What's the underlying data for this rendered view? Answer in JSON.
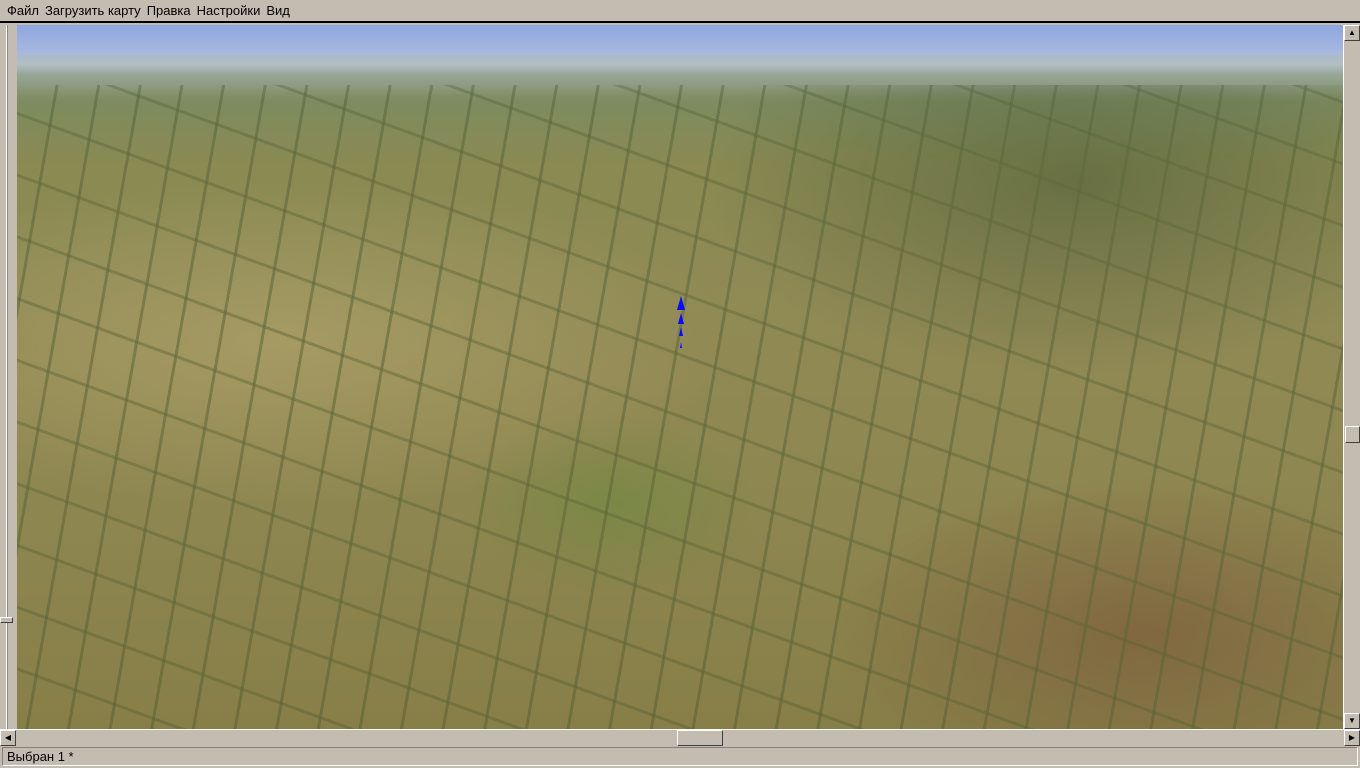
{
  "menu": {
    "items": [
      "Файл",
      "Загрузить карту",
      "Правка",
      "Настройки",
      "Вид"
    ]
  },
  "viewport": {
    "description_icon": "3d-terrain-view",
    "marker_color": "#0a0aff"
  },
  "statusbar": {
    "text": "Выбран 1 *"
  }
}
